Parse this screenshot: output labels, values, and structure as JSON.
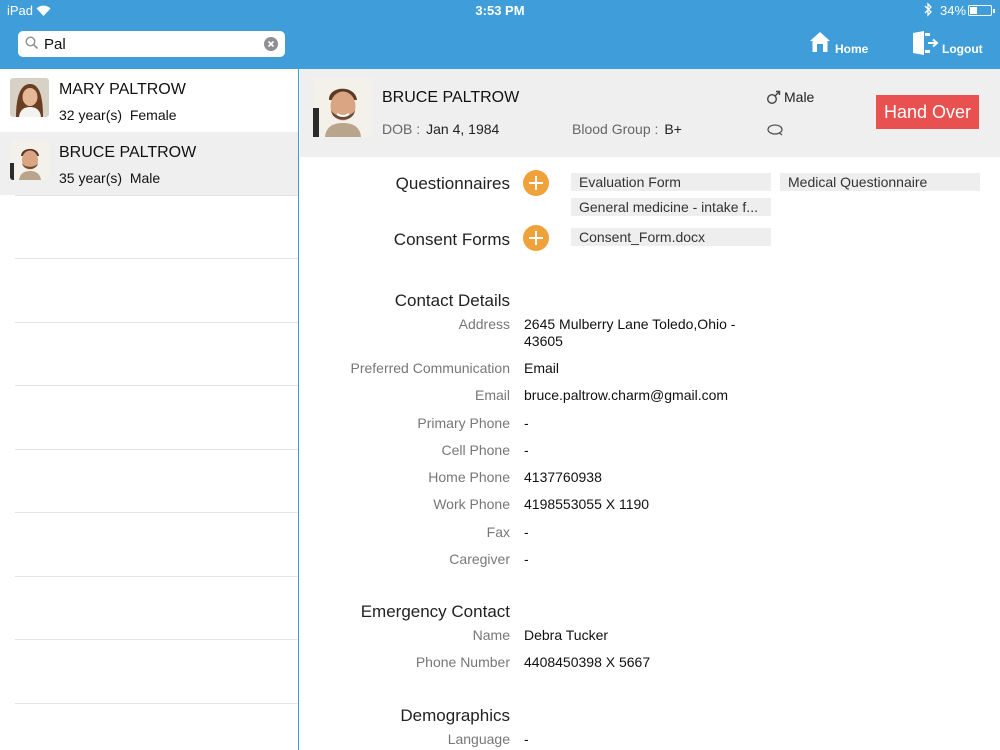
{
  "status_bar": {
    "carrier": "iPad",
    "time": "3:53 PM",
    "battery": "34%"
  },
  "search": {
    "value": "Pal",
    "placeholder": ""
  },
  "nav": {
    "home_label": "Home",
    "logout_label": "Logout"
  },
  "patients": [
    {
      "name": "MARY PALTROW",
      "age": "32 year(s)",
      "gender": "Female"
    },
    {
      "name": "BRUCE PALTROW",
      "age": "35 year(s)",
      "gender": "Male"
    }
  ],
  "patient": {
    "name": "BRUCE PALTROW",
    "dob_label": "DOB :",
    "dob": "Jan 4, 1984",
    "blood_label": "Blood Group :",
    "blood": "B+",
    "gender": "Male",
    "handover_label": "Hand Over"
  },
  "questionnaires": {
    "label": "Questionnaires",
    "items": [
      "Evaluation Form",
      "Medical  Questionnaire",
      "General medicine - intake f..."
    ]
  },
  "consent": {
    "label": "Consent Forms",
    "items": [
      "Consent_Form.docx"
    ]
  },
  "contact": {
    "heading": "Contact Details",
    "fields": [
      {
        "label": "Address",
        "value": "2645 Mulberry Lane Toledo,Ohio - 43605"
      },
      {
        "label": "Preferred Communication",
        "value": "Email"
      },
      {
        "label": "Email",
        "value": "bruce.paltrow.charm@gmail.com"
      },
      {
        "label": "Primary Phone",
        "value": "-"
      },
      {
        "label": "Cell Phone",
        "value": "-"
      },
      {
        "label": "Home Phone",
        "value": "4137760938"
      },
      {
        "label": "Work Phone",
        "value": "4198553055 X 1190"
      },
      {
        "label": "Fax",
        "value": "-"
      },
      {
        "label": "Caregiver",
        "value": "-"
      }
    ]
  },
  "emergency": {
    "heading": "Emergency Contact",
    "fields": [
      {
        "label": "Name",
        "value": "Debra Tucker"
      },
      {
        "label": "Phone Number",
        "value": "4408450398 X 5667"
      }
    ]
  },
  "demographics": {
    "heading": "Demographics",
    "fields": [
      {
        "label": "Language",
        "value": "-"
      }
    ]
  },
  "colors": {
    "accent": "#3f9ed9",
    "handover": "#e8514f",
    "add": "#f0a23a"
  }
}
